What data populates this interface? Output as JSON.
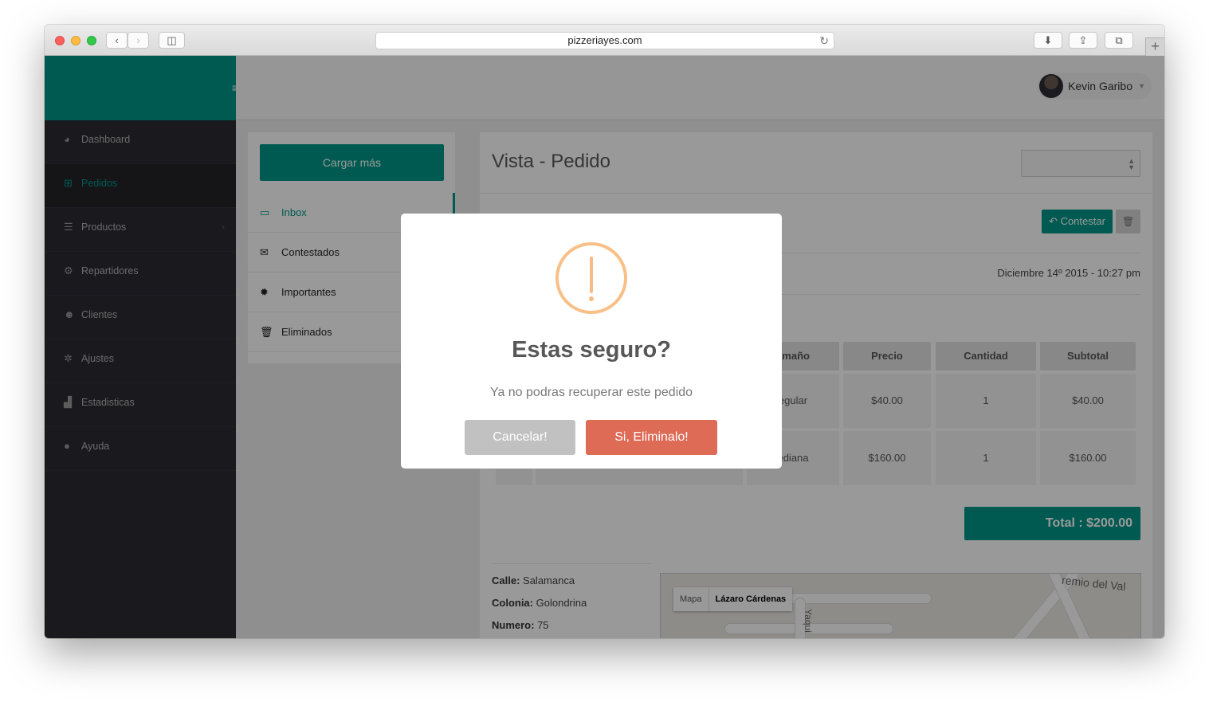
{
  "browser": {
    "url": "pizzeriayes.com"
  },
  "topbar": {
    "user_name": "Kevin Garibo"
  },
  "sidebar": {
    "items": [
      {
        "label": "Dashboard",
        "icon": "dashboard-icon",
        "active": false
      },
      {
        "label": "Pedidos",
        "icon": "cart-icon",
        "active": true
      },
      {
        "label": "Productos",
        "icon": "database-icon",
        "active": false
      },
      {
        "label": "Repartidores",
        "icon": "motorcycle-icon",
        "active": false
      },
      {
        "label": "Clientes",
        "icon": "users-icon",
        "active": false
      },
      {
        "label": "Ajustes",
        "icon": "gears-icon",
        "active": false
      },
      {
        "label": "Estadisticas",
        "icon": "bar-chart-icon",
        "active": false
      },
      {
        "label": "Ayuda",
        "icon": "question-icon",
        "active": false
      }
    ]
  },
  "mail": {
    "load_more": "Cargar más",
    "folders": [
      {
        "label": "Inbox",
        "icon": "inbox-icon"
      },
      {
        "label": "Contestados",
        "icon": "envelope-icon"
      },
      {
        "label": "Importantes",
        "icon": "badge-icon"
      },
      {
        "label": "Eliminados",
        "icon": "trash-icon"
      }
    ]
  },
  "order": {
    "title": "Vista - Pedido",
    "reply_label": "Contestar",
    "date": "Diciembre 14º 2015 - 10:27 pm",
    "table": {
      "headers": [
        "amaño",
        "Precio",
        "Cantidad",
        "Subtotal"
      ],
      "rows": [
        [
          "egular",
          "$40.00",
          "1",
          "$40.00"
        ],
        [
          "ediana",
          "$160.00",
          "1",
          "$160.00"
        ]
      ]
    },
    "total": "Total : $200.00",
    "address": {
      "calle_label": "Calle:",
      "calle": "Salamanca",
      "colonia_label": "Colonia:",
      "colonia": "Golondrina",
      "numero_label": "Numero:",
      "numero": "75"
    },
    "map": {
      "tab_map": "Mapa",
      "tab_selected": "Lázaro Cárdenas",
      "street_1": "remio del Val",
      "street_2": "Yaqui"
    }
  },
  "modal": {
    "title": "Estas seguro?",
    "text": "Ya no podras recuperar este pedido",
    "cancel_label": "Cancelar!",
    "confirm_label": "Si, Eliminalo!"
  },
  "colors": {
    "accent": "#009688",
    "sidebar": "#2b2b33",
    "warning": "#f8bb86",
    "danger": "#dd6b55"
  }
}
